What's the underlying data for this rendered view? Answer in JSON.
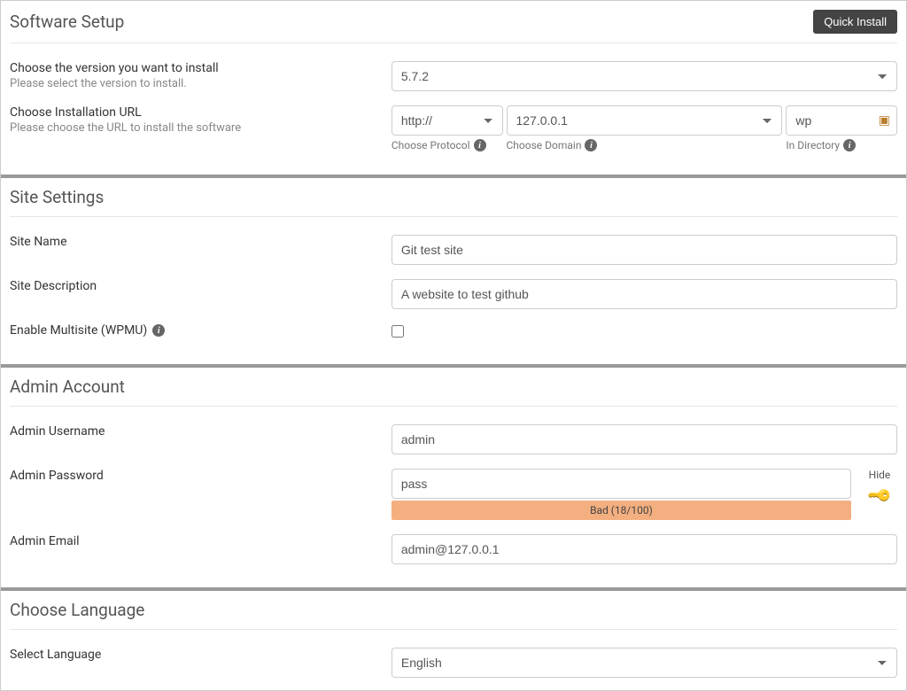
{
  "software_setup": {
    "title": "Software Setup",
    "quick_install": "Quick Install",
    "version_label": "Choose the version you want to install",
    "version_sub": "Please select the version to install.",
    "version_value": "5.7.2",
    "url_label": "Choose Installation URL",
    "url_sub": "Please choose the URL to install the software",
    "protocol_value": "http://",
    "domain_value": "127.0.0.1",
    "directory_value": "wp",
    "protocol_helper": "Choose Protocol",
    "domain_helper": "Choose Domain",
    "directory_helper": "In Directory"
  },
  "site_settings": {
    "title": "Site Settings",
    "site_name_label": "Site Name",
    "site_name_value": "Git test site",
    "site_desc_label": "Site Description",
    "site_desc_value": "A website to test github",
    "multisite_label": "Enable Multisite (WPMU)"
  },
  "admin_account": {
    "title": "Admin Account",
    "username_label": "Admin Username",
    "username_value": "admin",
    "password_label": "Admin Password",
    "password_value": "pass",
    "hide_label": "Hide",
    "strength_text": "Bad (18/100)",
    "email_label": "Admin Email",
    "email_value": "admin@127.0.0.1"
  },
  "choose_language": {
    "title": "Choose Language",
    "select_label": "Select Language",
    "select_value": "English"
  }
}
